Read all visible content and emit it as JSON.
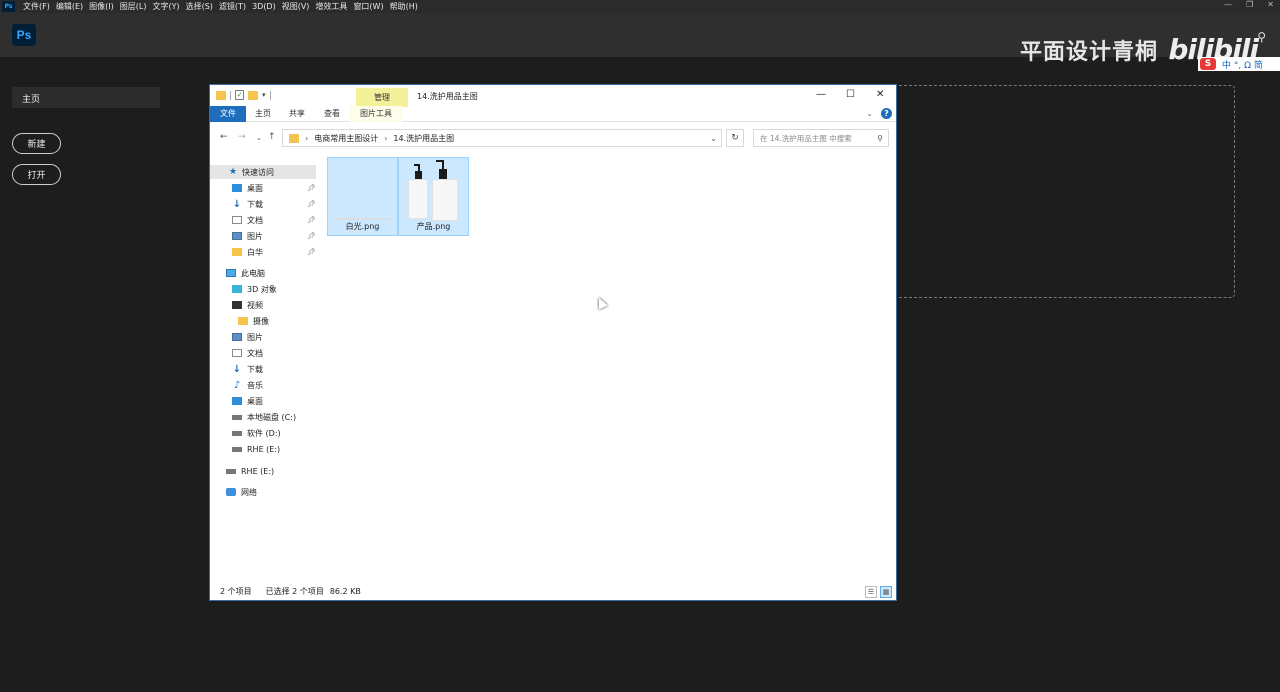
{
  "ps_menu": {
    "items": [
      "文件(F)",
      "编辑(E)",
      "图像(I)",
      "图层(L)",
      "文字(Y)",
      "选择(S)",
      "滤镜(T)",
      "3D(D)",
      "视图(V)",
      "增效工具",
      "窗口(W)",
      "帮助(H)"
    ],
    "mini_logo": "Ps"
  },
  "ps_header": {
    "logo": "Ps",
    "watermark": "平面设计青桐",
    "bilibili": "bilibili",
    "search_icon": "search-icon"
  },
  "ime": {
    "s": "S",
    "chars": "中 °, Ω 简"
  },
  "ps_left": {
    "home_label": "主页",
    "new_label": "新建",
    "open_label": "打开"
  },
  "explorer": {
    "manage_tab": "管理",
    "title": "14.洗护用品主图",
    "controls": {
      "min": "—",
      "max": "☐",
      "close": "✕"
    },
    "ribbon": {
      "file": "文件",
      "home": "主页",
      "share": "共享",
      "view": "查看",
      "picture_tools": "图片工具"
    },
    "address": {
      "crumb1": "电商常用主图设计",
      "crumb2": "14.洗护用品主图"
    },
    "search_placeholder": "在 14.洗护用品主图 中搜索",
    "nav": {
      "quick_access": "快速访问",
      "qa_items": [
        "桌面",
        "下载",
        "文档",
        "图片",
        "白华"
      ],
      "this_pc": "此电脑",
      "pc_items": [
        "3D 对象",
        "视频",
        "摄像",
        "图片",
        "文档",
        "下载",
        "音乐",
        "桌面",
        "本地磁盘 (C:)",
        "软件 (D:)",
        "RHE (E:)"
      ],
      "rhe_drive": "RHE (E:)",
      "network": "网络"
    },
    "files": [
      {
        "name": "白光.png"
      },
      {
        "name": "产品.png"
      }
    ],
    "status": {
      "count": "2 个项目",
      "selected": "已选择 2 个项目",
      "size": "86.2 KB"
    }
  }
}
